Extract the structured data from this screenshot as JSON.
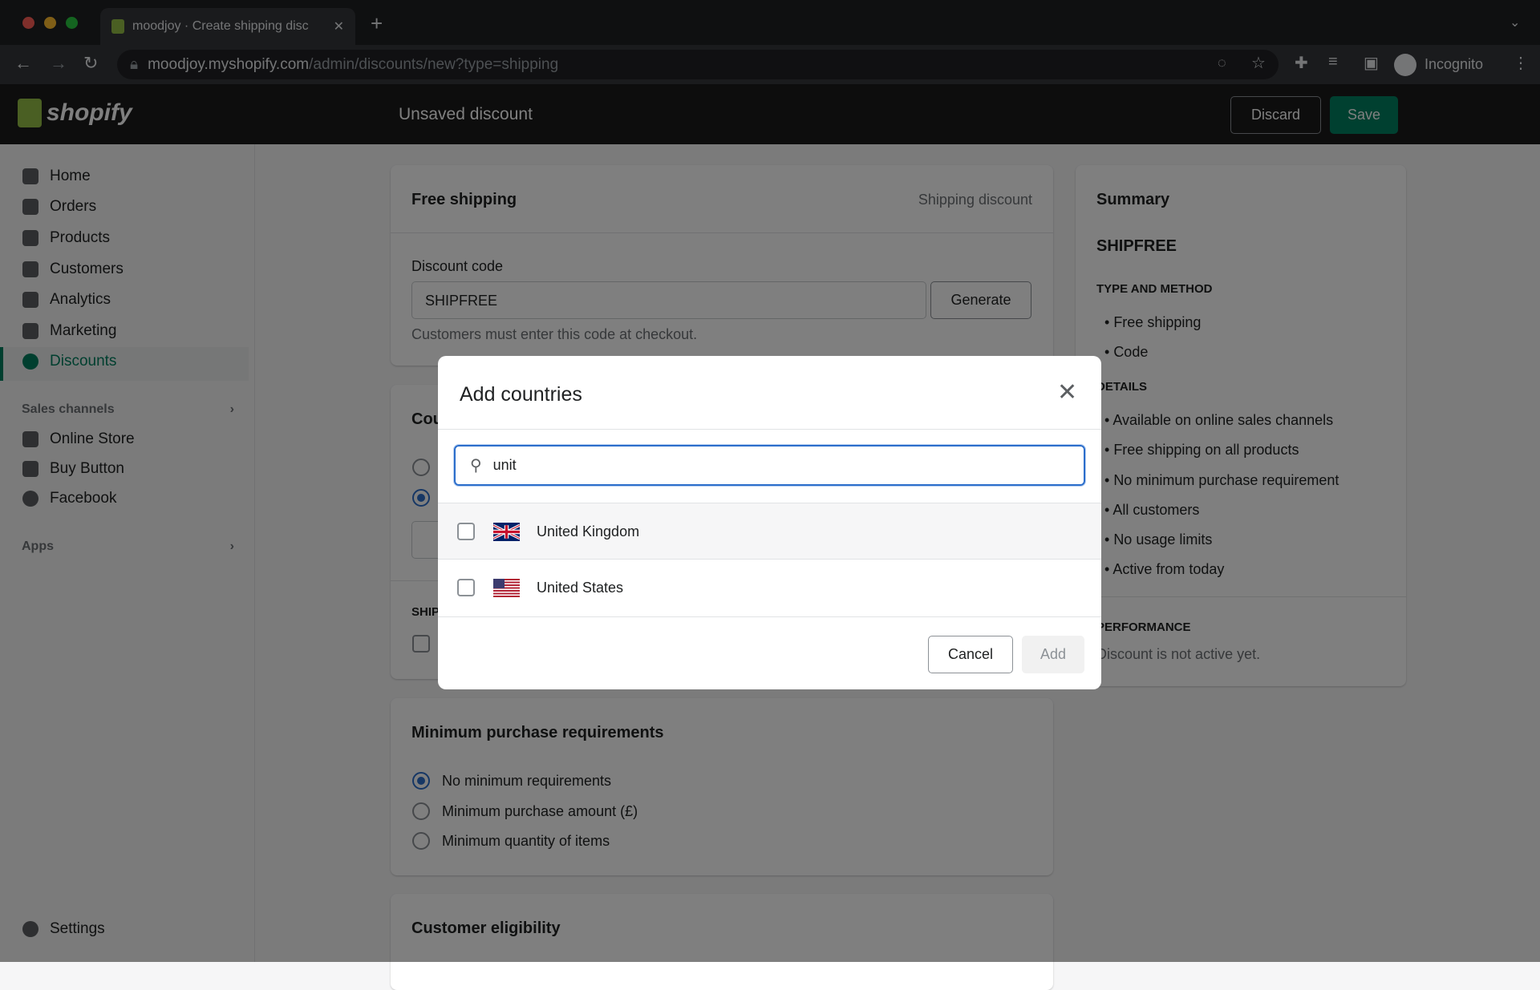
{
  "browser": {
    "tab_title": "moodjoy · Create shipping disc",
    "url_host": "moodjoy.myshopify.com",
    "url_path": "/admin/discounts/new?type=shipping",
    "profile": "Incognito"
  },
  "topbar": {
    "logo": "shopify",
    "title": "Unsaved discount",
    "discard": "Discard",
    "save": "Save"
  },
  "sidebar": {
    "items": [
      {
        "label": "Home"
      },
      {
        "label": "Orders"
      },
      {
        "label": "Products"
      },
      {
        "label": "Customers"
      },
      {
        "label": "Analytics"
      },
      {
        "label": "Marketing"
      },
      {
        "label": "Discounts"
      }
    ],
    "sales_channels": "Sales channels",
    "channels": [
      {
        "label": "Online Store"
      },
      {
        "label": "Buy Button"
      },
      {
        "label": "Facebook"
      }
    ],
    "apps": "Apps",
    "settings": "Settings"
  },
  "main": {
    "title": "Free shipping",
    "type": "Shipping discount",
    "code_label": "Discount code",
    "code_value": "SHIPFREE",
    "generate": "Generate",
    "code_help": "Customers must enter this code at checkout.",
    "countries_partial": "Cou",
    "shipping_partial": "SHIP",
    "min_title": "Minimum purchase requirements",
    "min_options": [
      "No minimum requirements",
      "Minimum purchase amount (£)",
      "Minimum quantity of items"
    ],
    "eligibility_title": "Customer eligibility"
  },
  "summary": {
    "title": "Summary",
    "code": "SHIPFREE",
    "type_heading": "TYPE AND METHOD",
    "type_items": [
      "Free shipping",
      "Code"
    ],
    "details_heading": "DETAILS",
    "details_items": [
      "Available on online sales channels",
      "Free shipping on all products",
      "No minimum purchase requirement",
      "All customers",
      "No usage limits",
      "Active from today"
    ],
    "performance_heading": "PERFORMANCE",
    "performance_text": "Discount is not active yet."
  },
  "modal": {
    "title": "Add countries",
    "search_value": "unit",
    "countries": [
      {
        "name": "United Kingdom"
      },
      {
        "name": "United States"
      }
    ],
    "cancel": "Cancel",
    "add": "Add"
  },
  "colors": {
    "accent": "#2c6ecb",
    "save": "#008060",
    "active_nav": "#007f5f"
  }
}
